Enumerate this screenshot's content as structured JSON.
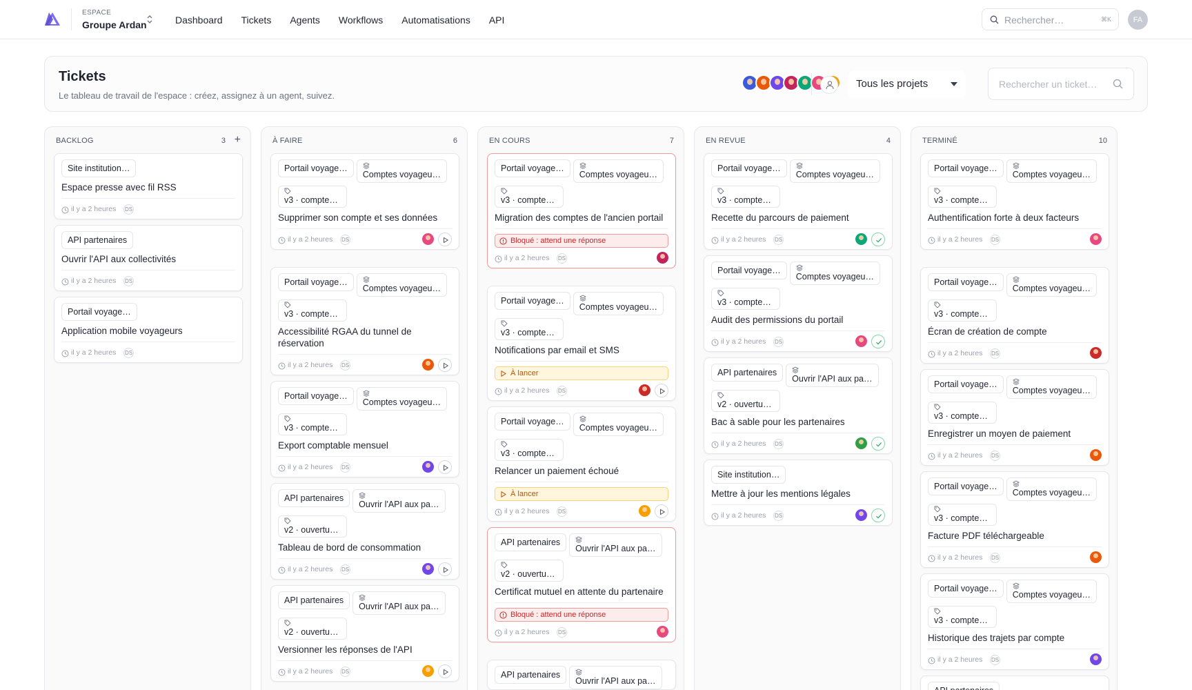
{
  "workspace": {
    "kicker": "ESPACE",
    "name": "Groupe Ardan"
  },
  "nav": [
    "Dashboard",
    "Tickets",
    "Agents",
    "Workflows",
    "Automatisations",
    "API"
  ],
  "search": {
    "placeholder": "Rechercher…",
    "shortcut": "⌘K"
  },
  "user": {
    "initials": "FA"
  },
  "header": {
    "title": "Tickets",
    "subtitle": "Le tableau de travail de l'espace : créez, assignez à un agent, suivez.",
    "project_filter": "Tous les projets",
    "ticket_search_placeholder": "Rechercher un ticket…"
  },
  "team_colors": [
    "#3b5bdb",
    "#e8590c",
    "#7048e8",
    "#c2255c",
    "#0ca678",
    "#e64980",
    "#f59f00"
  ],
  "colors": {
    "border": "#e5e7eb",
    "blocked": "#ef9a9a",
    "blocked_text": "#c62828",
    "pending": "#f6d27a",
    "done": "#86d6a8"
  },
  "columns": [
    {
      "title": "BACKLOG",
      "count": "3",
      "add": "+",
      "action": "none",
      "cards": [
        {
          "chips": [
            {
              "text": "Site institution…"
            }
          ],
          "title": "Espace presse avec fil RSS",
          "time": "il y a 2 heures",
          "badge": "DS"
        },
        {
          "chips": [
            {
              "text": "API partenaires"
            }
          ],
          "title": "Ouvrir l'API aux collectivités",
          "time": "il y a 2 heures",
          "badge": "DS"
        },
        {
          "chips": [
            {
              "text": "Portail voyage…"
            }
          ],
          "title": "Application mobile voyageurs",
          "time": "il y a 2 heures",
          "badge": "DS"
        }
      ]
    },
    {
      "title": "À FAIRE",
      "count": "6",
      "action": "play",
      "cards": [
        {
          "project": "Portail voyage…",
          "epic": "Comptes voyageu…",
          "version": "v3 · comptes…",
          "title": "Supprimer son compte et ses données",
          "time": "il y a 2 heures",
          "badge": "DS",
          "avatar": "#e64980"
        },
        {
          "project": "Portail voyage…",
          "epic": "Comptes voyageu…",
          "version": "v3 · comptes…",
          "title": "Accessibilité RGAA du tunnel de réservation",
          "time": "il y a 2 heures",
          "badge": "DS",
          "avatar": "#e8590c"
        },
        {
          "project": "Portail voyage…",
          "epic": "Comptes voyageu…",
          "version": "v3 · comptes…",
          "title": "Export comptable mensuel",
          "time": "il y a 2 heures",
          "badge": "DS",
          "avatar": "#7048e8"
        },
        {
          "project": "API partenaires",
          "epic": "Ouvrir l'API aux pa…",
          "version": "v2 · ouvertur…",
          "title": "Tableau de bord de consommation",
          "time": "il y a 2 heures",
          "badge": "DS",
          "avatar": "#7048e8"
        },
        {
          "project": "API partenaires",
          "epic": "Ouvrir l'API aux pa…",
          "version": "v2 · ouvertur…",
          "title": "Versionner les réponses de l'API",
          "time": "il y a 2 heures",
          "badge": "DS",
          "avatar": "#f59f00"
        }
      ]
    },
    {
      "title": "EN COURS",
      "count": "7",
      "action": "play",
      "cards": [
        {
          "project": "Portail voyage…",
          "epic": "Comptes voyageu…",
          "version": "v3 · comptes…",
          "title": "Migration des comptes de l'ancien portail",
          "status": "Bloqué : attend une réponse",
          "status_type": "red",
          "time": "il y a 2 heures",
          "badge": "DS",
          "avatar": "#c2255c",
          "no_action": true
        },
        {
          "project": "Portail voyage…",
          "epic": "Comptes voyageu…",
          "version": "v3 · comptes…",
          "title": "Notifications par email et SMS",
          "status": "À lancer",
          "status_type": "amber",
          "time": "il y a 2 heures",
          "badge": "DS",
          "avatar": "#c92a2a"
        },
        {
          "project": "Portail voyage…",
          "epic": "Comptes voyageu…",
          "version": "v3 · comptes…",
          "title": "Relancer un paiement échoué",
          "status": "À lancer",
          "status_type": "amber",
          "time": "il y a 2 heures",
          "badge": "DS",
          "avatar": "#f59f00"
        },
        {
          "project": "API partenaires",
          "epic": "Ouvrir l'API aux pa…",
          "version": "v2 · ouvertur…",
          "title": "Certificat mutuel en attente du partenaire",
          "status": "Bloqué : attend une réponse",
          "status_type": "red",
          "time": "il y a 2 heures",
          "badge": "DS",
          "avatar": "#e64980",
          "no_action": true
        },
        {
          "project": "API partenaires",
          "epic": "Ouvrir l'API aux pa…",
          "version": "",
          "title": "",
          "time": "",
          "badge": ""
        }
      ]
    },
    {
      "title": "EN REVUE",
      "count": "4",
      "action": "check",
      "cards": [
        {
          "project": "Portail voyage…",
          "epic": "Comptes voyageu…",
          "version": "v3 · comptes…",
          "title": "Recette du parcours de paiement",
          "time": "il y a 2 heures",
          "badge": "DS",
          "avatar": "#0ca678"
        },
        {
          "project": "Portail voyage…",
          "epic": "Comptes voyageu…",
          "version": "v3 · comptes…",
          "title": "Audit des permissions du portail",
          "time": "il y a 2 heures",
          "badge": "DS",
          "avatar": "#e64980"
        },
        {
          "project": "API partenaires",
          "epic": "Ouvrir l'API aux pa…",
          "version": "v2 · ouvertur…",
          "title": "Bac à sable pour les partenaires",
          "time": "il y a 2 heures",
          "badge": "DS",
          "avatar": "#2f9e44"
        },
        {
          "chips": [
            {
              "text": "Site institution…"
            }
          ],
          "title": "Mettre à jour les mentions légales",
          "time": "il y a 2 heures",
          "badge": "DS",
          "avatar": "#7048e8"
        }
      ]
    },
    {
      "title": "TERMINÉ",
      "count": "10",
      "action": "none",
      "cards": [
        {
          "project": "Portail voyage…",
          "epic": "Comptes voyageu…",
          "version": "v3 · comptes…",
          "title": "Authentification forte à deux facteurs",
          "time": "il y a 2 heures",
          "badge": "DS",
          "avatar": "#e64980"
        },
        {
          "project": "Portail voyage…",
          "epic": "Comptes voyageu…",
          "version": "v3 · comptes…",
          "title": "Écran de création de compte",
          "time": "il y a 2 heures",
          "badge": "DS",
          "avatar": "#c92a2a"
        },
        {
          "project": "Portail voyage…",
          "epic": "Comptes voyageu…",
          "version": "v3 · comptes…",
          "title": "Enregistrer un moyen de paiement",
          "time": "il y a 2 heures",
          "badge": "DS",
          "avatar": "#e8590c"
        },
        {
          "project": "Portail voyage…",
          "epic": "Comptes voyageu…",
          "version": "v3 · comptes…",
          "title": "Facture PDF téléchargeable",
          "time": "il y a 2 heures",
          "badge": "DS",
          "avatar": "#e8590c"
        },
        {
          "project": "Portail voyage…",
          "epic": "Comptes voyageu…",
          "version": "v3 · comptes…",
          "title": "Historique des trajets par compte",
          "time": "il y a 2 heures",
          "badge": "DS",
          "avatar": "#7048e8"
        },
        {
          "project": "API partenaires",
          "epic": "",
          "version": "",
          "title": "",
          "time": "",
          "badge": ""
        }
      ]
    }
  ]
}
